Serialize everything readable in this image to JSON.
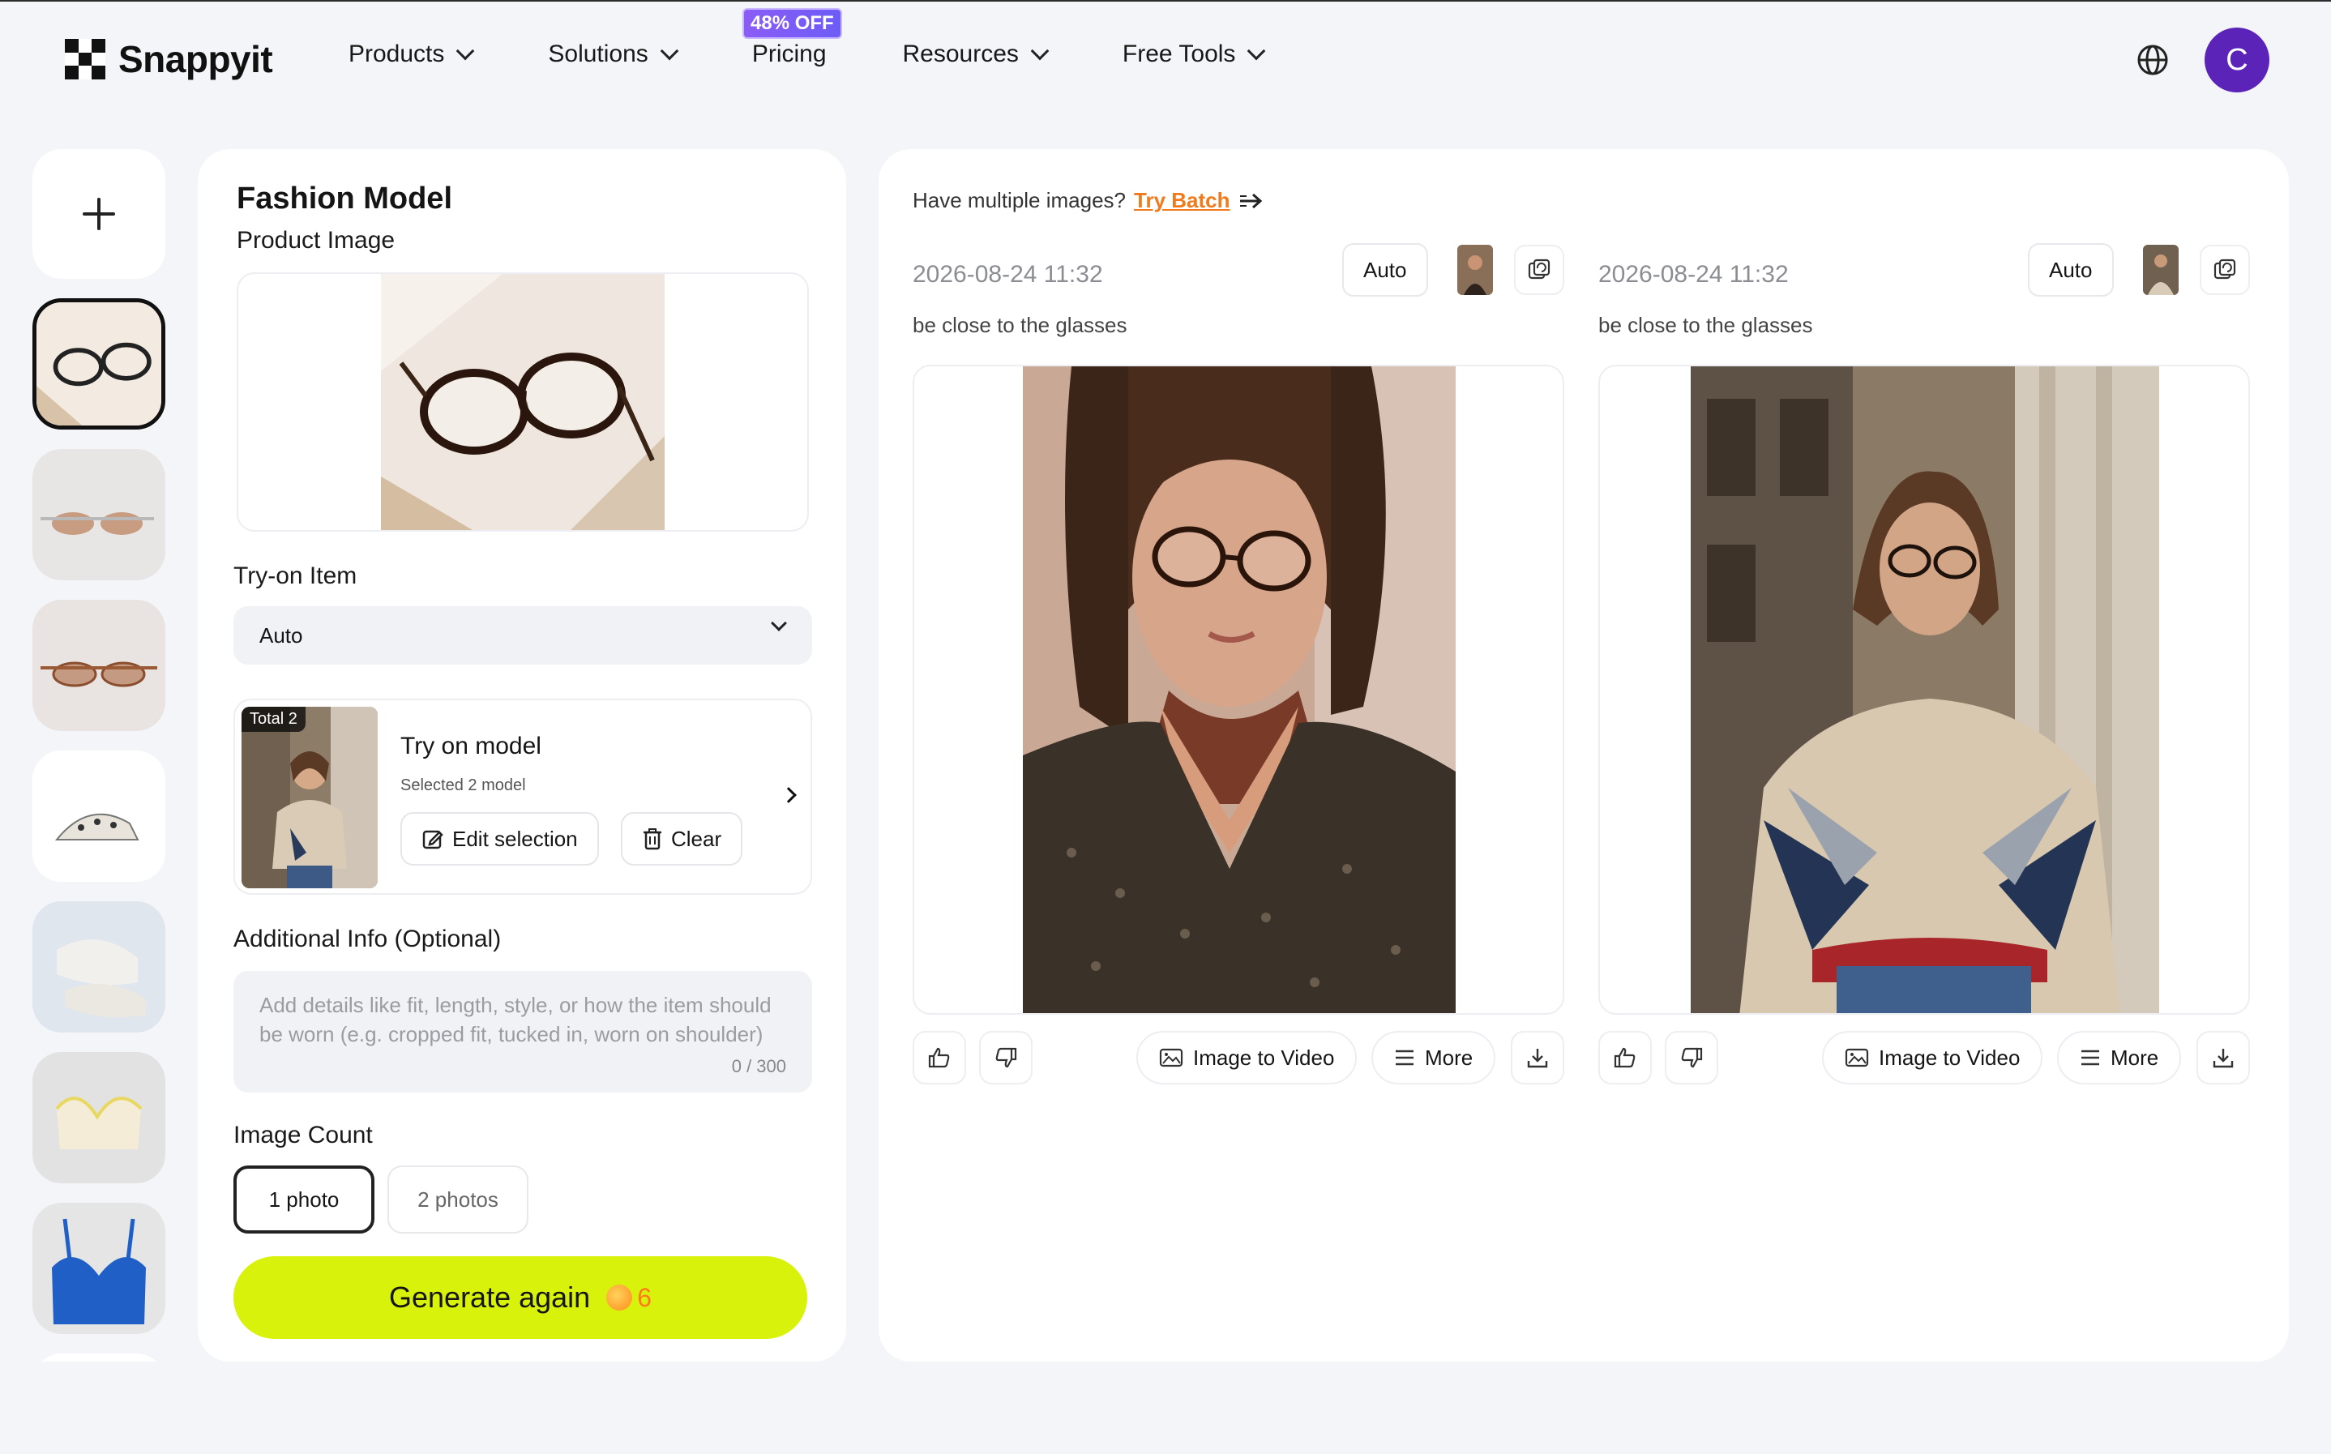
{
  "brand": {
    "name": "Snappyit"
  },
  "nav": {
    "items": [
      {
        "label": "Products",
        "dropdown": true
      },
      {
        "label": "Solutions",
        "dropdown": true
      },
      {
        "label": "Pricing",
        "dropdown": false
      },
      {
        "label": "Resources",
        "dropdown": true
      },
      {
        "label": "Free Tools",
        "dropdown": true
      }
    ],
    "pricing_badge": "48% OFF",
    "avatar_initial": "C",
    "icons": {
      "language": "globe-icon"
    }
  },
  "rail": {
    "add_icon": "plus-icon",
    "thumbs": [
      "glasses",
      "sunglasses-silver",
      "sunglasses-brown",
      "heels",
      "sneakers",
      "bra-beige",
      "bra-blue",
      "item-partial"
    ]
  },
  "form": {
    "title": "Fashion Model",
    "product_image_label": "Product Image",
    "tryon_item_label": "Try-on Item",
    "tryon_item_value": "Auto",
    "model_card": {
      "badge": "Total 2",
      "title": "Try on model",
      "subtitle": "Selected 2 model",
      "edit_label": "Edit selection",
      "clear_label": "Clear"
    },
    "additional_label": "Additional Info (Optional)",
    "additional_placeholder": "Add details like fit, length, style, or how the item should be worn (e.g. cropped fit, tucked in, worn on shoulder)",
    "additional_counter": "0 / 300",
    "image_count_label": "Image Count",
    "count_options": [
      "1 photo",
      "2 photos"
    ],
    "count_selected": "1 photo",
    "generate_label": "Generate again",
    "generate_cost": "6"
  },
  "results": {
    "batch_text": "Have multiple images?",
    "batch_link": "Try Batch",
    "items": [
      {
        "timestamp": "2026-08-24 11:32",
        "mode": "Auto",
        "prompt": "be close to the glasses",
        "video_label": "Image to Video",
        "more_label": "More"
      },
      {
        "timestamp": "2026-08-24 11:32",
        "mode": "Auto",
        "prompt": "be close to the glasses",
        "video_label": "Image to Video",
        "more_label": "More"
      }
    ]
  },
  "colors": {
    "accent_generate": "#d8f20c",
    "avatar": "#5b23b8",
    "batch_link": "#f07a1c",
    "badge": "#7c5cf6"
  }
}
